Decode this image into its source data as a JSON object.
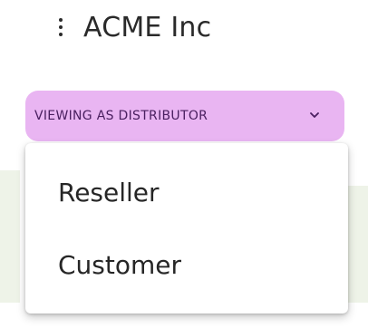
{
  "header": {
    "menu_icon": "kebab-vertical-icon",
    "company_name": "ACME Inc"
  },
  "role_selector": {
    "label": "VIEWING AS DISTRIBUTOR",
    "icon": "chevron-down-icon",
    "accent_color": "#e9b5f2"
  },
  "role_menu": {
    "items": [
      {
        "label": "Reseller"
      },
      {
        "label": "Customer"
      }
    ]
  }
}
